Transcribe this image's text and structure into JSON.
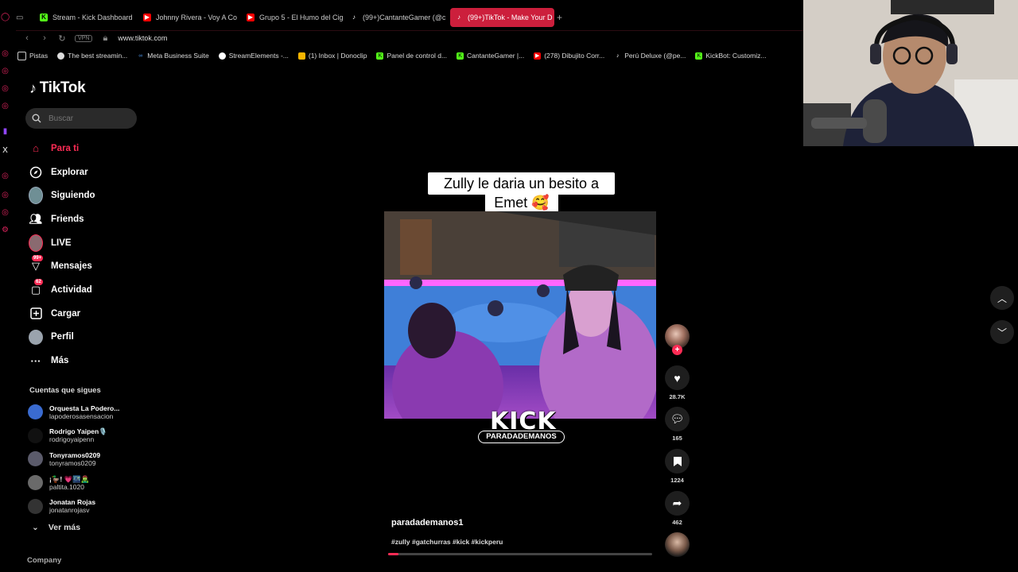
{
  "colors": {
    "accent": "#fe2c55",
    "browser_accent": "#cc1f3c",
    "kick_green": "#53fc18"
  },
  "browser": {
    "tabs": [
      {
        "label": "Stream - Kick Dashboard",
        "icon": "kick-icon"
      },
      {
        "label": "Johnny Rivera - Voy A Co",
        "icon": "youtube-icon"
      },
      {
        "label": "Grupo 5 - El Humo del Cig",
        "icon": "youtube-icon"
      },
      {
        "label": "(99+)CantanteGamer (@c",
        "icon": "tiktok-icon"
      },
      {
        "label": "(99+)TikTok - Make Your D",
        "icon": "tiktok-icon"
      }
    ],
    "new_tab": "+",
    "vpn": "VPN",
    "url": "www.tiktok.com",
    "bookmarks": [
      {
        "label": "Pistas",
        "icon": "folder-icon"
      },
      {
        "label": "The best streamin...",
        "icon": "obs-icon"
      },
      {
        "label": "Meta Business Suite",
        "icon": "meta-icon"
      },
      {
        "label": "StreamElements -...",
        "icon": "streamelements-icon"
      },
      {
        "label": "(1) Inbox | Donoclip",
        "icon": "donoclip-icon"
      },
      {
        "label": "Panel de control d...",
        "icon": "kick-icon"
      },
      {
        "label": "CantanteGamer |...",
        "icon": "kick-icon"
      },
      {
        "label": "(278) Dibujito Corr...",
        "icon": "youtube-icon"
      },
      {
        "label": "Perú Deluxe (@pe...",
        "icon": "tiktok-icon"
      },
      {
        "label": "KickBot: Customiz...",
        "icon": "kick-icon"
      }
    ]
  },
  "tiktok": {
    "logo": "TikTok",
    "search": {
      "placeholder": "Buscar"
    },
    "nav": [
      {
        "label": "Para ti",
        "icon": "home-icon"
      },
      {
        "label": "Explorar",
        "icon": "compass-icon"
      },
      {
        "label": "Siguiendo",
        "icon": "following-avatar-icon"
      },
      {
        "label": "Friends",
        "icon": "friends-icon"
      },
      {
        "label": "LIVE",
        "icon": "live-avatar-icon"
      },
      {
        "label": "Mensajes",
        "icon": "messages-icon",
        "badge": "99+"
      },
      {
        "label": "Actividad",
        "icon": "activity-icon",
        "badge": "62"
      },
      {
        "label": "Cargar",
        "icon": "upload-icon"
      },
      {
        "label": "Perfil",
        "icon": "profile-icon"
      },
      {
        "label": "Más",
        "icon": "more-icon"
      }
    ],
    "following_title": "Cuentas que sigues",
    "following": [
      {
        "name": "Orquesta La Podero...",
        "handle": "lapoderosasensacion",
        "color": "#3a6bd0"
      },
      {
        "name": "Rodrigo Yaipen🎙️",
        "handle": "rodrigoyaipenn",
        "color": "#111111"
      },
      {
        "name": "Tonyramos0209",
        "handle": "tonyramos0209",
        "color": "#5b5b6b"
      },
      {
        "name": "¡🦆! 💗🌃🧟‍♂️",
        "handle": "paltita.1020",
        "color": "#6a6a6a"
      },
      {
        "name": "Jonatan Rojas",
        "handle": "jonatanrojasv",
        "color": "#333333"
      }
    ],
    "see_more": "Ver más",
    "company": "Company"
  },
  "video": {
    "caption_line1": "Zully le daria un besito a",
    "caption_line2": "Emet 🥰",
    "overlay_brand": "KICK",
    "overlay_handle": "PARADADEMANOS",
    "author": "paradademanos1",
    "hashtags": "#zully #gatchurras #kick #kickperu",
    "progress": 0.04,
    "follow_plus": "+",
    "likes": "28.7K",
    "comments": "165",
    "saves": "1224",
    "shares": "462"
  },
  "scroll": {
    "up": "up",
    "down": "down"
  }
}
